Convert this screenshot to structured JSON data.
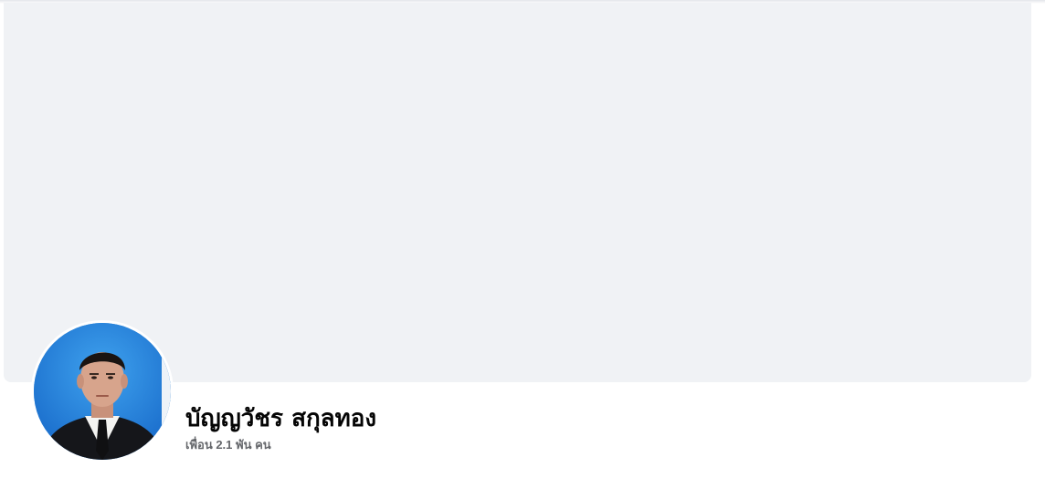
{
  "profile": {
    "name": "บัญญวัชร สกุลทอง",
    "friends_text": "เพื่อน 2.1 พัน คน"
  },
  "colors": {
    "cover_background": "#f0f2f5",
    "name_color": "#050505",
    "friends_color": "#65676b",
    "avatar_background": "#1e7fd9"
  },
  "icons": {
    "avatar": "profile-photo"
  }
}
